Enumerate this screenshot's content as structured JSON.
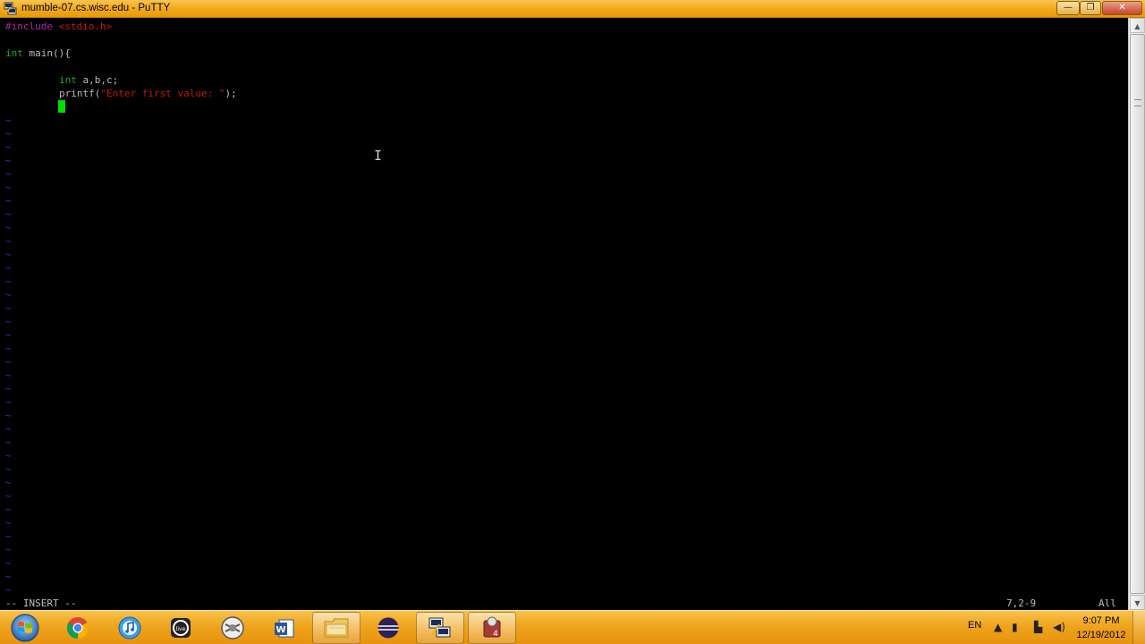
{
  "window": {
    "title": "mumble-07.cs.wisc.edu - PuTTY",
    "minimize_glyph": "—",
    "maximize_glyph": "❐",
    "close_glyph": "✕"
  },
  "editor": {
    "lines": {
      "l1_directive": "#include",
      "l1_header": "<stdio.h>",
      "l3_type": "int",
      "l3_rest": " main(){",
      "l5_type": "int",
      "l5_rest": " a,b,c;",
      "l6_func": "printf(",
      "l6_string": "\"Enter first value: \"",
      "l6_end": ");"
    },
    "empty_marker": "~",
    "status_mode": "-- INSERT --",
    "status_position": "7,2-9",
    "status_percent": "All"
  },
  "taskbar": {
    "apps": [
      {
        "name": "chrome-icon"
      },
      {
        "name": "itunes-icon"
      },
      {
        "name": "uvrive-icon"
      },
      {
        "name": "vmware-icon"
      },
      {
        "name": "word-icon"
      },
      {
        "name": "file-explorer-icon"
      },
      {
        "name": "eclipse-icon"
      },
      {
        "name": "putty-icon"
      },
      {
        "name": "app-badge-icon",
        "badge": "4"
      }
    ],
    "tray": {
      "language": "EN",
      "time": "9:07 PM",
      "date": "12/19/2012"
    }
  },
  "colors": {
    "preprocessor": "#a825a8",
    "string": "#c41818",
    "keyword": "#1ea81e",
    "tilde": "#3434c8",
    "cursor": "#00e000",
    "titlebar": "#f0a818"
  }
}
